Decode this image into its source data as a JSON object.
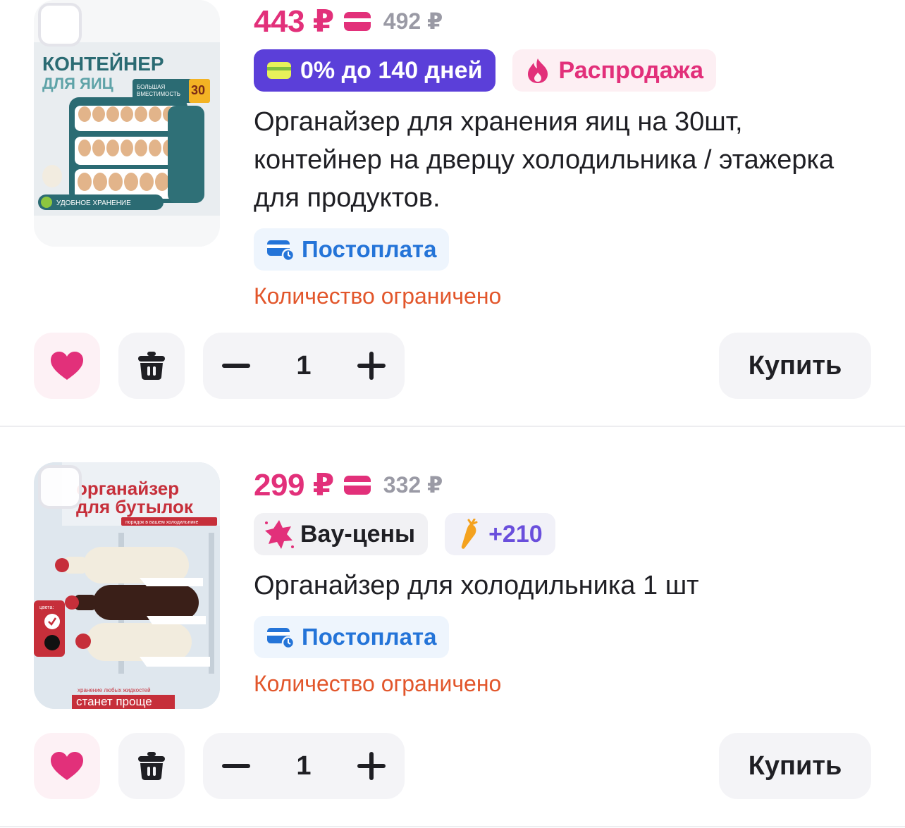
{
  "items": [
    {
      "price": "443 ₽",
      "old_price": "492 ₽",
      "badges": [
        "0% до 140 дней",
        "Распродажа"
      ],
      "title": "Органайзер для хранения яиц на 30шт, контейнер на дверцу холодильника / этажерка для продуктов.",
      "postpay": "Постоплата",
      "limited": "Количество ограничено",
      "quantity": "1",
      "buy_label": "Купить",
      "image_text": {
        "line1": "КОНТЕЙНЕР",
        "line2": "ДЛЯ ЯИЦ",
        "capacity": "БОЛЬШАЯ ВМЕСТИМОСТЬ",
        "count": "30",
        "count_unit": "штук",
        "storage": "УДОБНОЕ ХРАНЕНИЕ"
      }
    },
    {
      "price": "299 ₽",
      "old_price": "332 ₽",
      "badges": [
        "Вау-цены",
        "+210"
      ],
      "title": "Органайзер для холодильника 1 шт",
      "postpay": "Постоплата",
      "limited": "Количество ограничено",
      "quantity": "1",
      "buy_label": "Купить",
      "image_text": {
        "line1": "органайзер",
        "line2": "для бутылок",
        "sub": "порядок в вашем холодильнике",
        "colors": "цвета:",
        "bottom1": "хранение любых жидкостей",
        "bottom2": "станет проще"
      }
    }
  ],
  "colors": {
    "accent": "#e2307a",
    "installment": "#5b3fd9",
    "postpay": "#2474d8",
    "limited": "#e2562b"
  },
  "icons": [
    "checkbox-icon",
    "card-icon",
    "fire-icon",
    "star-icon",
    "carrot-icon",
    "postpay-icon",
    "heart-icon",
    "trash-icon",
    "minus-icon",
    "plus-icon"
  ]
}
